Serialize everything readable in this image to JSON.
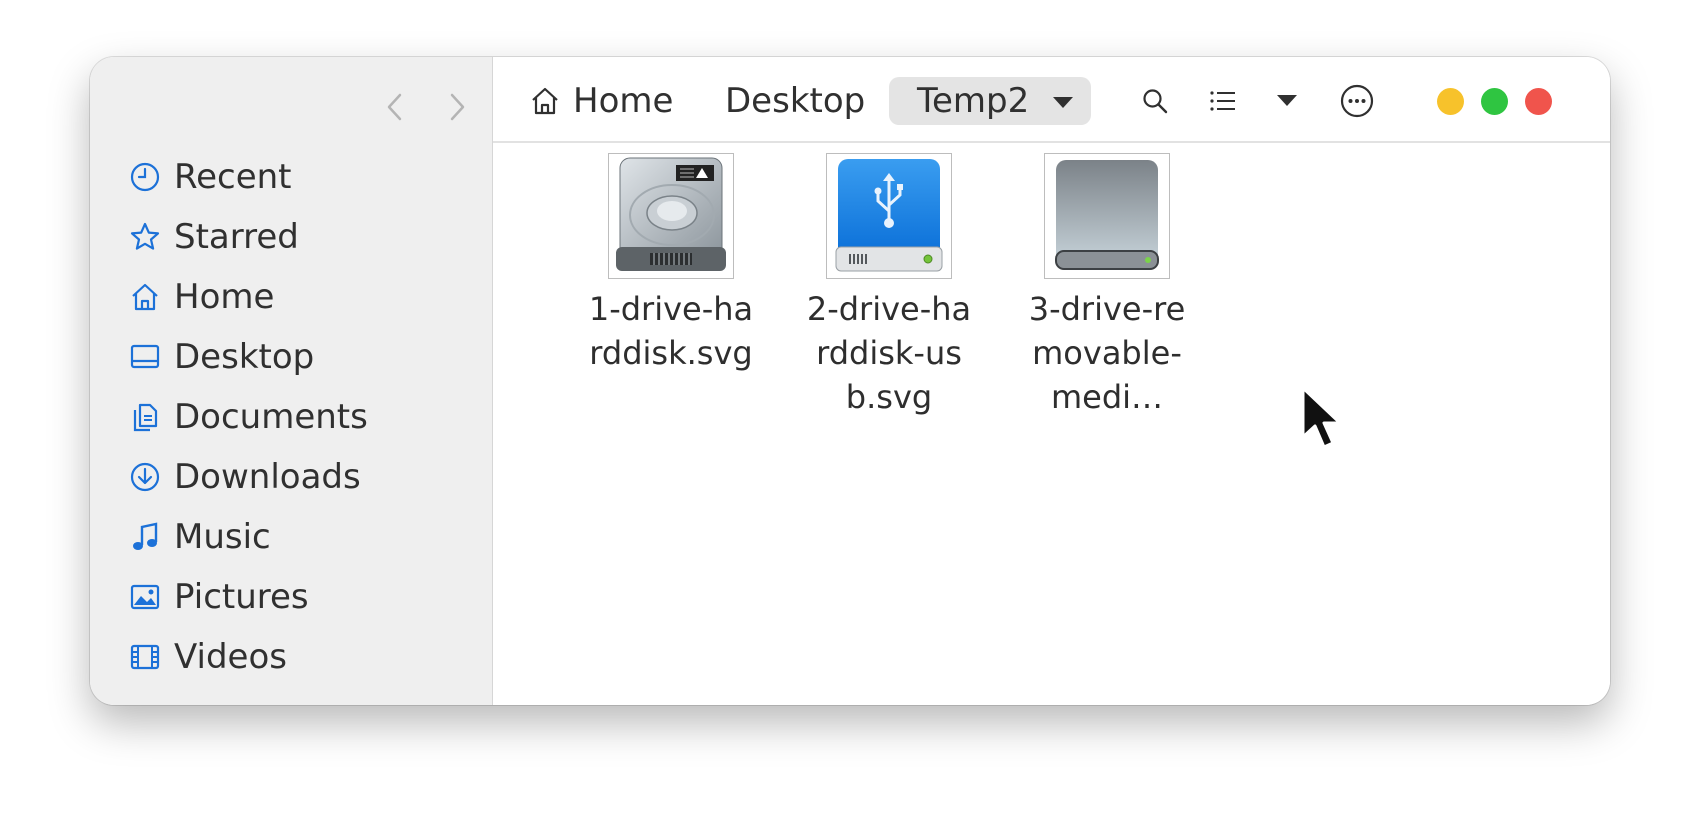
{
  "sidebar": {
    "items": [
      {
        "label": "Recent",
        "icon": "clock-icon"
      },
      {
        "label": "Starred",
        "icon": "star-icon"
      },
      {
        "label": "Home",
        "icon": "home-icon"
      },
      {
        "label": "Desktop",
        "icon": "desktop-icon"
      },
      {
        "label": "Documents",
        "icon": "documents-icon"
      },
      {
        "label": "Downloads",
        "icon": "downloads-icon"
      },
      {
        "label": "Music",
        "icon": "music-icon"
      },
      {
        "label": "Pictures",
        "icon": "pictures-icon"
      },
      {
        "label": "Videos",
        "icon": "videos-icon"
      }
    ]
  },
  "breadcrumb": {
    "home": "Home",
    "desktop": "Desktop",
    "current": "Temp2"
  },
  "files": [
    {
      "name": "1-drive-harddisk.svg",
      "icon": "harddisk-icon"
    },
    {
      "name": "2-drive-harddisk-usb.svg",
      "icon": "usb-drive-icon"
    },
    {
      "name": "3-drive-removable-medi…",
      "icon": "removable-media-icon"
    }
  ],
  "colors": {
    "accent": "#1c71d8",
    "sidebar_bg": "#efefef",
    "minimize": "#f7c22b",
    "maximize": "#2fc541",
    "close": "#f0544c"
  }
}
